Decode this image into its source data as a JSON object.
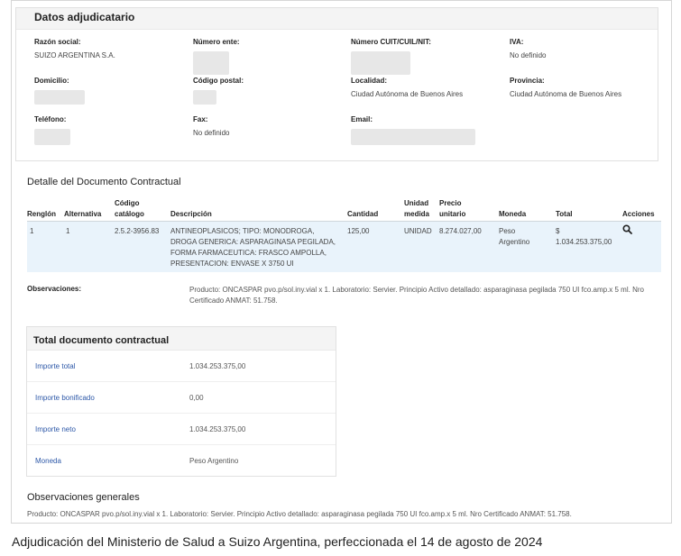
{
  "adjudicatario": {
    "title": "Datos adjudicatario",
    "razon_social_label": "Razón social:",
    "razon_social_value": "SUIZO ARGENTINA S.A.",
    "numero_ente_label": "Número ente:",
    "cuit_label": "Número CUIT/CUIL/NIT:",
    "iva_label": "IVA:",
    "iva_value": "No definido",
    "domicilio_label": "Domicilio:",
    "codigo_postal_label": "Código postal:",
    "localidad_label": "Localidad:",
    "localidad_value": "Ciudad Autónoma de Buenos Aires",
    "provincia_label": "Provincia:",
    "provincia_value": "Ciudad Autónoma de Buenos Aires",
    "telefono_label": "Teléfono:",
    "fax_label": "Fax:",
    "fax_value": "No definido",
    "email_label": "Email:"
  },
  "detalle": {
    "title": "Detalle del Documento Contractual",
    "headers": {
      "renglon": "Renglón",
      "alternativa": "Alternativa",
      "codigo": "Código catálogo",
      "descripcion": "Descripción",
      "cantidad": "Cantidad",
      "unidad": "Unidad medida",
      "precio": "Precio unitario",
      "moneda": "Moneda",
      "total": "Total",
      "acciones": "Acciones"
    },
    "rows": [
      {
        "renglon": "1",
        "alternativa": "1",
        "codigo": "2.5.2-3956.83",
        "descripcion": "ANTINEOPLASICOS; TIPO: MONODROGA, DROGA GENERICA: ASPARAGINASA PEGILADA, FORMA FARMACEUTICA: FRASCO AMPOLLA, PRESENTACION: ENVASE X 3750 UI",
        "cantidad": "125,00",
        "unidad": "UNIDAD",
        "precio": "8.274.027,00",
        "moneda": "Peso Argentino",
        "total_symbol": "$",
        "total_value": "1.034.253.375,00",
        "accion_icon": "search-icon"
      }
    ]
  },
  "observaciones": {
    "label": "Observaciones:",
    "text": "Producto: ONCASPAR pvo.p/sol.iny.vial x 1. Laboratorio: Servier. Principio Activo detallado: asparaginasa pegilada 750 UI fco.amp.x 5 ml. Nro Certificado ANMAT: 51.758."
  },
  "totales": {
    "title": "Total documento contractual",
    "rows": [
      {
        "label": "Importe total",
        "value": "1.034.253.375,00"
      },
      {
        "label": "Importe bonificado",
        "value": "0,00"
      },
      {
        "label": "Importe neto",
        "value": "1.034.253.375,00"
      },
      {
        "label": "Moneda",
        "value": "Peso Argentino"
      }
    ]
  },
  "observaciones_generales": {
    "title": "Observaciones generales",
    "text": "Producto: ONCASPAR pvo.p/sol.iny.vial x 1. Laboratorio: Servier. Principio Activo detallado: asparaginasa pegilada 750 UI fco.amp.x 5 ml. Nro Certificado ANMAT: 51.758."
  },
  "caption": "Adjudicación del Ministerio de Salud a Suizo Argentina, perfeccionada el 14 de agosto de 2024"
}
